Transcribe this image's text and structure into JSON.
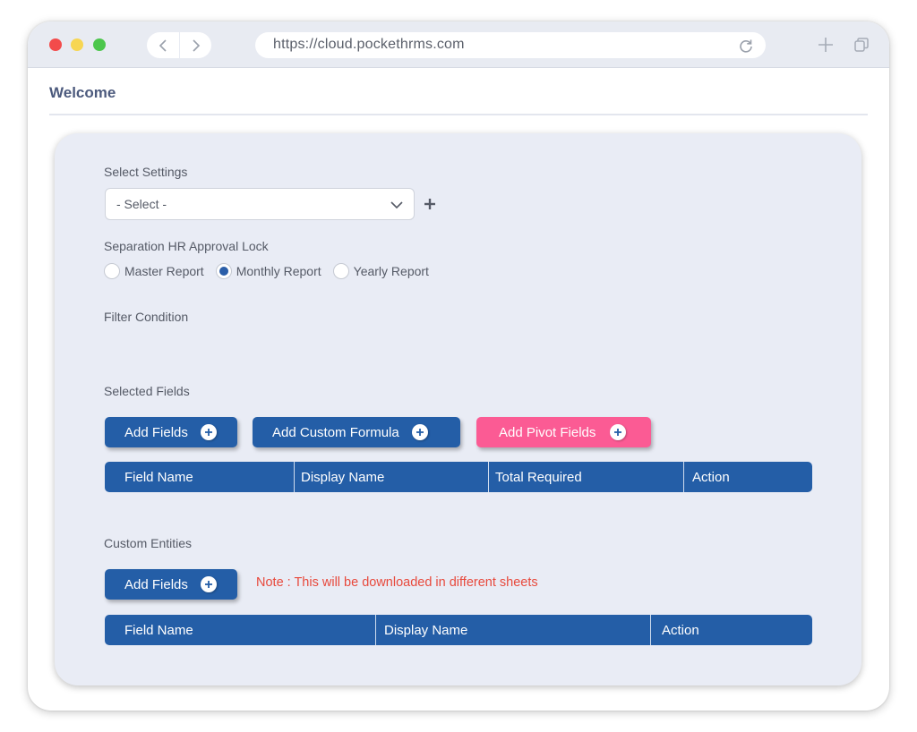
{
  "browser": {
    "url": "https://cloud.pockethrms.com",
    "icons": {
      "close": "red-dot",
      "minimize": "yellow-dot",
      "maximize": "green-dot",
      "back": "chevron-left-icon",
      "forward": "chevron-right-icon",
      "reload": "reload-icon",
      "new_tab": "plus-icon",
      "tabs": "tabs-icon"
    }
  },
  "page": {
    "title": "Welcome"
  },
  "form": {
    "select_settings": {
      "label": "Select Settings",
      "value": "- Select -",
      "add_icon": "plus-icon"
    },
    "approval_lock": {
      "label": "Separation HR Approval Lock",
      "options": [
        {
          "label": "Master Report",
          "checked": false
        },
        {
          "label": "Monthly Report",
          "checked": true
        },
        {
          "label": "Yearly Report",
          "checked": false
        }
      ]
    },
    "filter_condition": {
      "label": "Filter Condition"
    },
    "selected_fields": {
      "label": "Selected Fields",
      "buttons": [
        {
          "label": "Add Fields",
          "color": "#245ea7"
        },
        {
          "label": "Add Custom Formula",
          "color": "#245ea7"
        },
        {
          "label": "Add Pivot Fields",
          "color": "#fb5b94"
        }
      ],
      "columns": [
        "Field Name",
        "Display Name",
        "Total Required",
        "Action"
      ]
    },
    "custom_entities": {
      "label": "Custom Entities",
      "button": {
        "label": "Add Fields",
        "color": "#245ea7"
      },
      "note": "Note : This will be downloaded in different sheets",
      "columns": [
        "Field Name",
        "Display Name",
        "Action"
      ]
    }
  },
  "colors": {
    "primary": "#245ea7",
    "accent_pink": "#fb5b94",
    "note_red": "#e8493c",
    "card_bg": "#e9ecf5"
  }
}
